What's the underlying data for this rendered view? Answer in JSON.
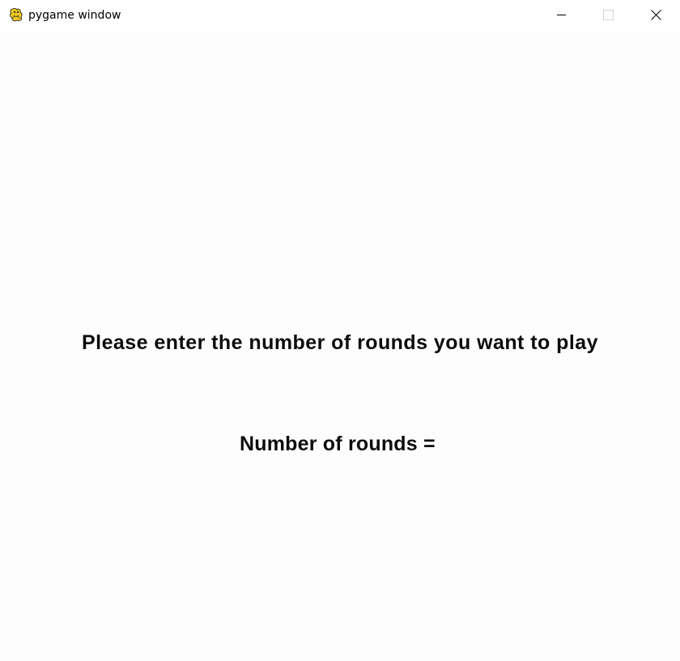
{
  "window": {
    "title": "pygame window",
    "icon": "pygame-snake-icon",
    "controls": {
      "minimize_icon": "minimize-icon",
      "maximize_icon": "maximize-icon",
      "close_icon": "close-icon"
    }
  },
  "screen": {
    "prompt": "Please enter the number of rounds you want to play",
    "rounds_label": "Number of rounds =",
    "rounds_value": ""
  },
  "colors": {
    "background": "#fdfdfd",
    "text": "#0c0c0c",
    "icon_yellow": "#f2c81e",
    "icon_outline": "#3a3a3a"
  }
}
